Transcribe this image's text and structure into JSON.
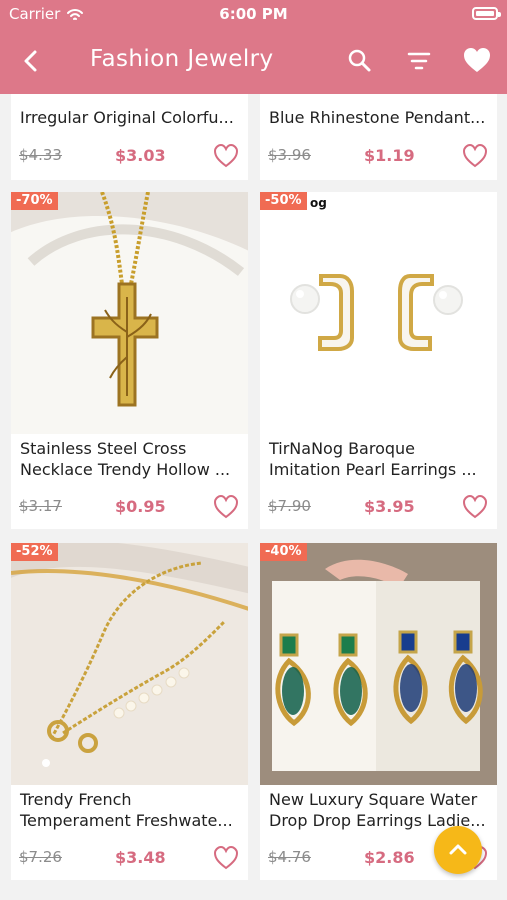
{
  "status_bar": {
    "carrier": "Carrier",
    "time": "6:00 PM"
  },
  "header": {
    "title": "Fashion Jewelry",
    "colors": {
      "header": "#dd7889",
      "price": "#d66b80",
      "badge": "#f06b53",
      "fab": "#f6b818"
    },
    "icons": [
      "back-arrow-icon",
      "search-icon",
      "filter-icon",
      "heart-icon"
    ]
  },
  "products": [
    {
      "title": "Irregular Original Colorfu...",
      "old_price": "$4.33",
      "new_price": "$3.03"
    },
    {
      "title": "Blue Rhinestone Pendant...",
      "old_price": "$3.96",
      "new_price": "$1.19"
    },
    {
      "discount": "-70%",
      "title": "Stainless Steel Cross\nNecklace Trendy Hollow ...",
      "old_price": "$3.17",
      "new_price": "$0.95"
    },
    {
      "discount": "-50%",
      "brand_fragment": "og",
      "title": "TirNaNog Baroque\nImitation Pearl Earrings ...",
      "old_price": "$7.90",
      "new_price": "$3.95"
    },
    {
      "discount": "-52%",
      "title": "Trendy French\nTemperament Freshwate...",
      "old_price": "$7.26",
      "new_price": "$3.48"
    },
    {
      "discount": "-40%",
      "title": "New Luxury Square Water\nDrop Drop Earrings Ladie...",
      "old_price": "$4.76",
      "new_price": "$2.86"
    }
  ]
}
